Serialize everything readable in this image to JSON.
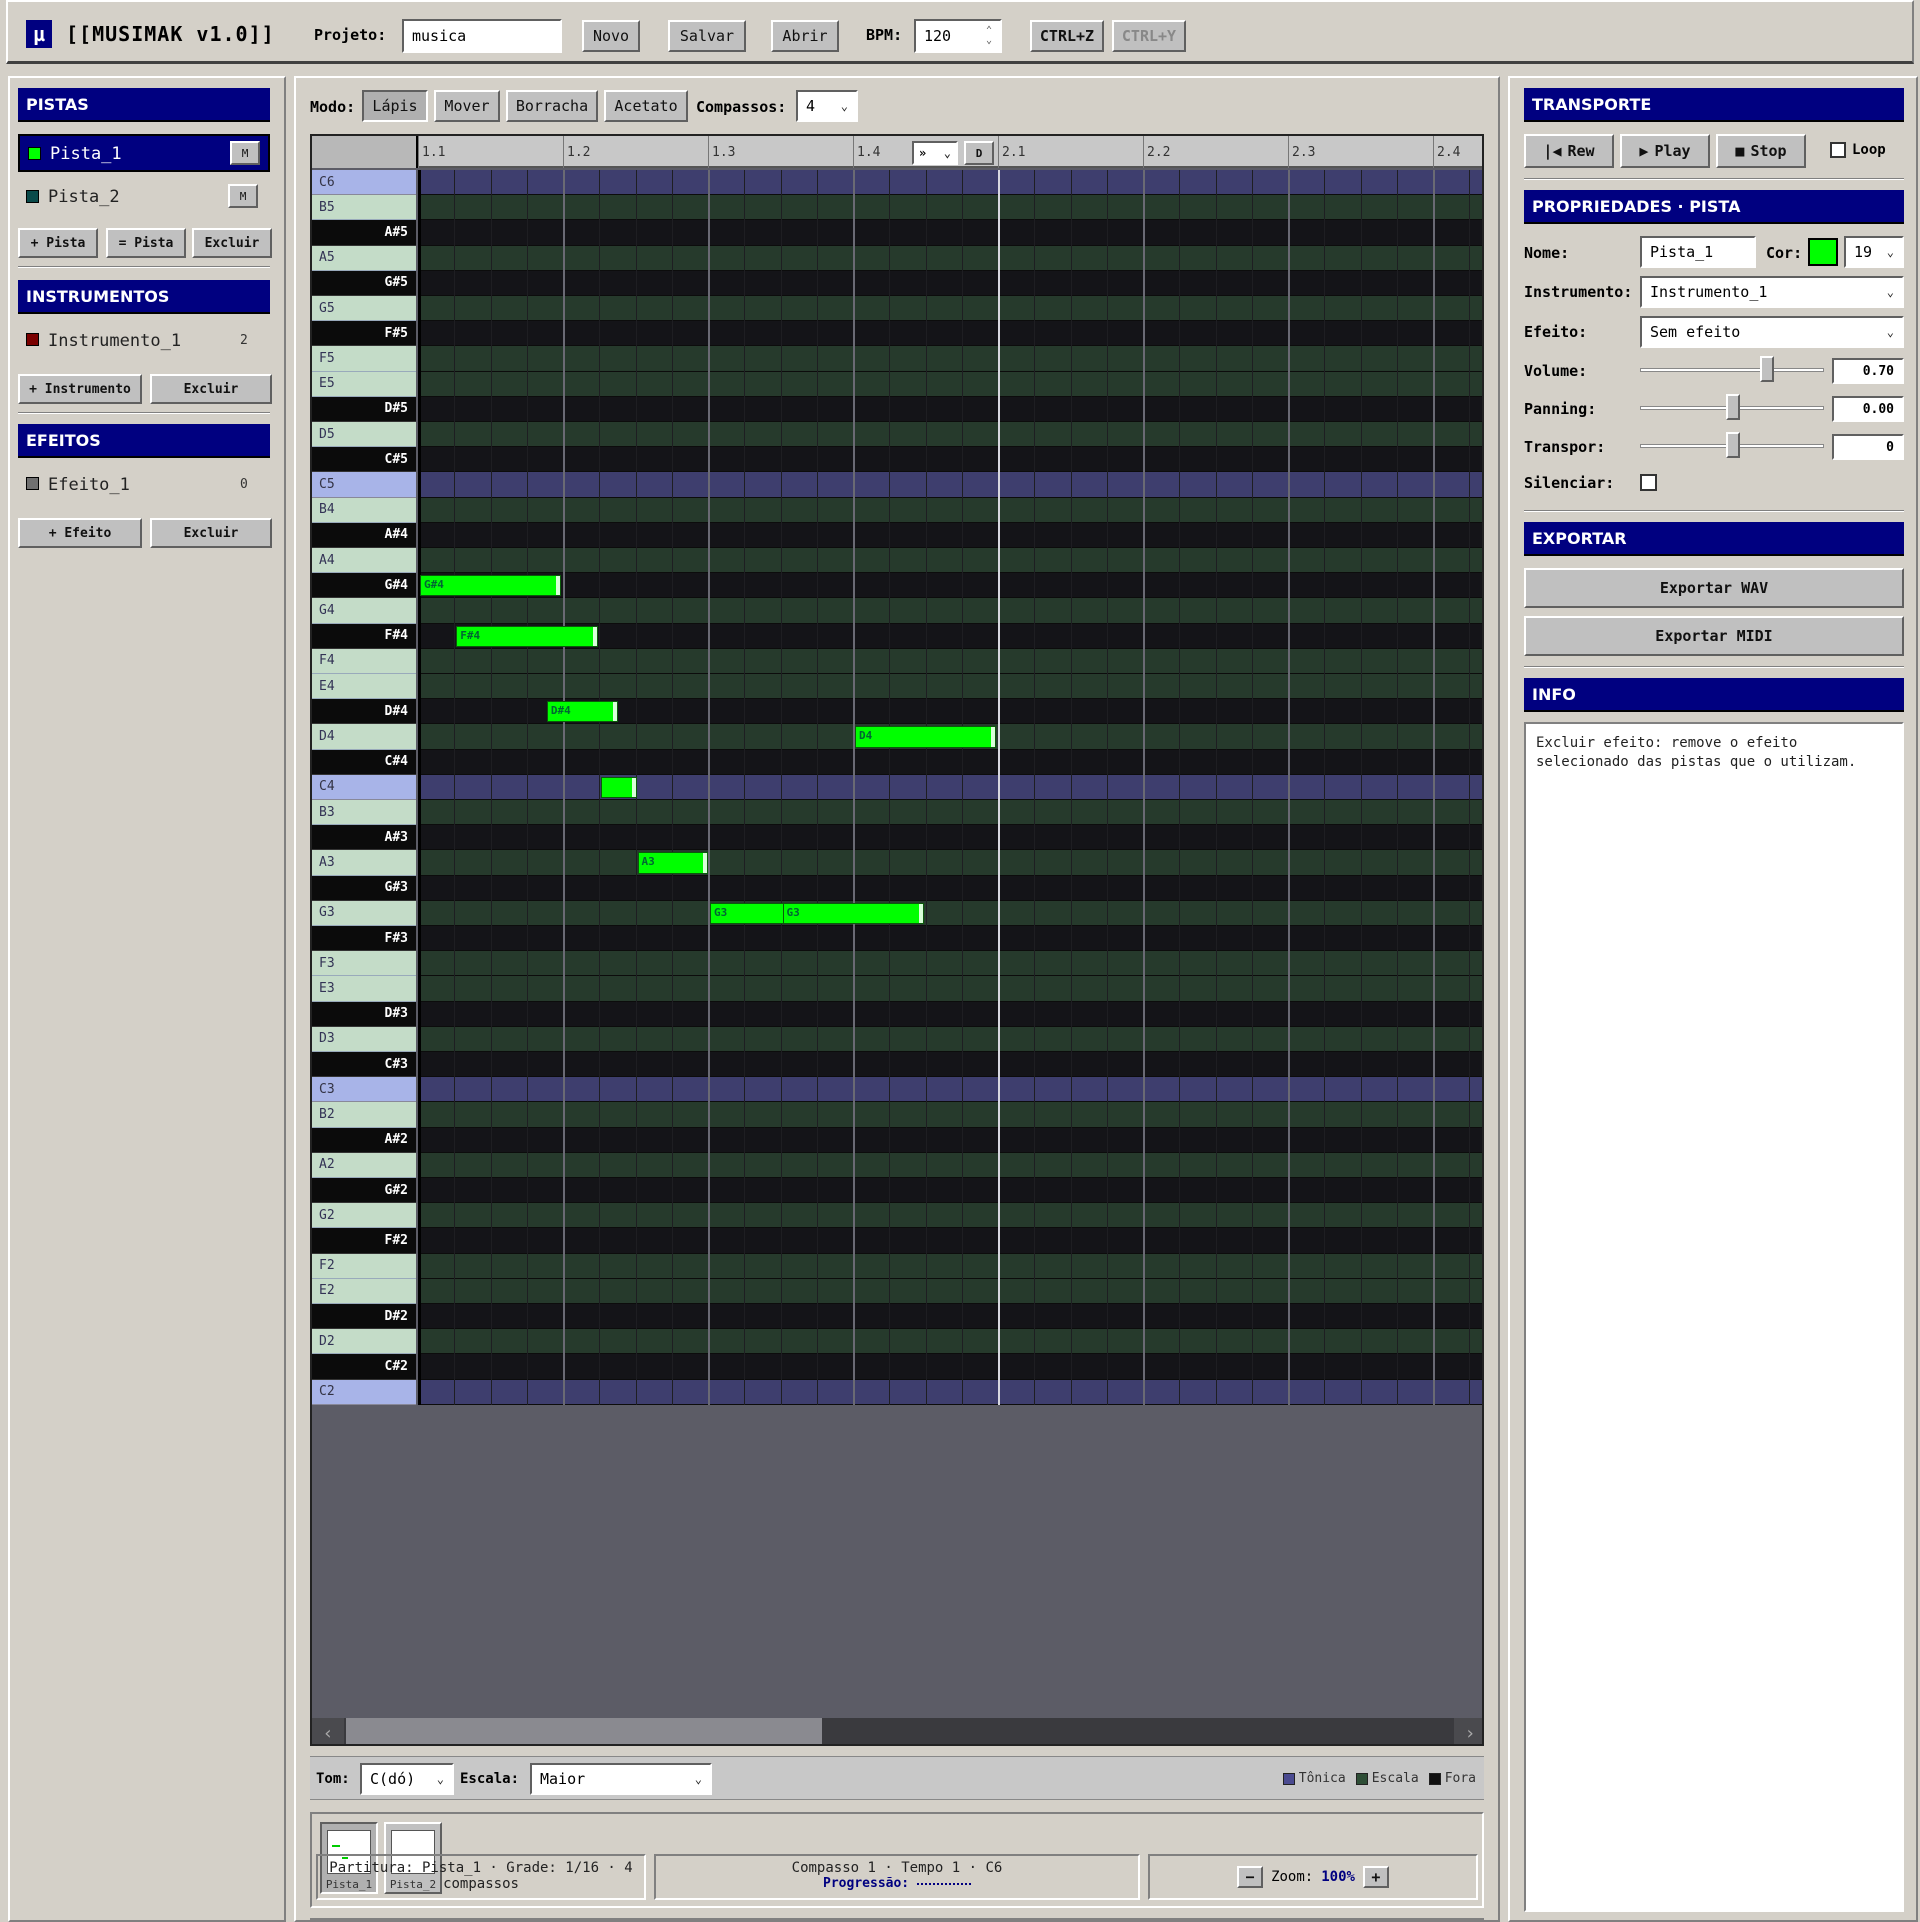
{
  "app": {
    "logo": "µ",
    "title": "[[MUSIMAK v1.0]]"
  },
  "toolbar": {
    "project_label": "Projeto:",
    "project_value": "musica",
    "new_label": "Novo",
    "save_label": "Salvar",
    "open_label": "Abrir",
    "bpm_label": "BPM:",
    "bpm_value": "120",
    "undo_label": "CTRL+Z",
    "redo_label": "CTRL+Y"
  },
  "tracks": {
    "header": "PISTAS",
    "items": [
      {
        "name": "Pista_1",
        "color": "#00ff00",
        "mute": "M",
        "selected": true
      },
      {
        "name": "Pista_2",
        "color": "#0a4a4a",
        "mute": "M",
        "selected": false
      }
    ],
    "add_label": "+ Pista",
    "dup_label": "= Pista",
    "delete_label": "Excluir"
  },
  "instruments": {
    "header": "INSTRUMENTOS",
    "items": [
      {
        "name": "Instrumento_1",
        "color": "#7a0000",
        "count": "2"
      }
    ],
    "add_label": "+ Instrumento",
    "delete_label": "Excluir"
  },
  "effects": {
    "header": "EFEITOS",
    "items": [
      {
        "name": "Efeito_1",
        "color": "#707070",
        "count": "0"
      }
    ],
    "add_label": "+ Efeito",
    "delete_label": "Excluir"
  },
  "editor": {
    "mode_label": "Modo:",
    "modes": [
      "Lápis",
      "Mover",
      "Borracha",
      "Acetato"
    ],
    "active_mode": "Lápis",
    "measures_label": "Compassos:",
    "measures_value": "4",
    "ruler": [
      "1.1",
      "1.2",
      "1.3",
      "1.4",
      "2.1",
      "2.2",
      "2.3",
      "2.4"
    ],
    "ruler_select": "»",
    "ruler_d": "D",
    "keys": [
      "C6",
      "B5",
      "A#5",
      "A5",
      "G#5",
      "G5",
      "F#5",
      "F5",
      "E5",
      "D#5",
      "D5",
      "C#5",
      "C5",
      "B4",
      "A#4",
      "A4",
      "G#4",
      "G4",
      "F#4",
      "F4",
      "E4",
      "D#4",
      "D4",
      "C#4",
      "C4",
      "B3",
      "A#3",
      "A3",
      "G#3",
      "G3",
      "F#3",
      "F3",
      "E3",
      "D#3",
      "D3",
      "C#3",
      "C3",
      "B2",
      "A#2",
      "A2",
      "G#2",
      "G2",
      "F#2",
      "F2",
      "E2",
      "D#2",
      "D2",
      "C#2",
      "C2"
    ],
    "notes": [
      {
        "pitch": "G#4",
        "start": 0,
        "length": 2,
        "label": "G#4"
      },
      {
        "pitch": "F#4",
        "start": 1,
        "length": 2,
        "label": "F#4"
      },
      {
        "pitch": "D#4",
        "start": 3.5,
        "length": 1,
        "label": "D#4"
      },
      {
        "pitch": "D4",
        "start": 12,
        "length": 2,
        "label": "D4"
      },
      {
        "pitch": "C4",
        "start": 5,
        "length": 0.5,
        "label": ""
      },
      {
        "pitch": "A3",
        "start": 6,
        "length": 1,
        "label": "A3"
      },
      {
        "pitch": "G3",
        "start": 8,
        "length": 2,
        "label": "G3"
      },
      {
        "pitch": "G3",
        "start": 10,
        "length": 2,
        "label": "G3"
      }
    ],
    "key_label": "Tom:",
    "key_value": "C(dó)",
    "scale_label": "Escala:",
    "scale_value": "Maior",
    "legend": [
      {
        "label": "Tônica",
        "color": "#4a4a90"
      },
      {
        "label": "Escala",
        "color": "#2e4e36"
      },
      {
        "label": "Fora",
        "color": "#111111"
      }
    ],
    "thumbnails": [
      "Pista_1",
      "Pista_2"
    ]
  },
  "status": {
    "left": "Partitura: Pista_1 · Grade: 1/16 · 4 compassos",
    "center": "Compasso 1 · Tempo 1 · C6",
    "progress_label": "Progressão:",
    "zoom_label": "Zoom:",
    "zoom_value": "100%",
    "zoom_minus": "−",
    "zoom_plus": "+"
  },
  "transport": {
    "header": "TRANSPORTE",
    "rew_label": "Rew",
    "play_label": "Play",
    "stop_label": "Stop",
    "loop_label": "Loop"
  },
  "properties": {
    "header": "PROPRIEDADES · PISTA",
    "name_label": "Nome:",
    "name_value": "Pista_1",
    "color_label": "Cor:",
    "color_value": "#00ff00",
    "color_index": "19",
    "instrument_label": "Instrumento:",
    "instrument_value": "Instrumento_1",
    "effect_label": "Efeito:",
    "effect_value": "Sem efeito",
    "volume_label": "Volume:",
    "volume_value": "0.70",
    "panning_label": "Panning:",
    "panning_value": "0.00",
    "transpose_label": "Transpor:",
    "transpose_value": "0",
    "mute_label": "Silenciar:"
  },
  "export": {
    "header": "EXPORTAR",
    "wav_label": "Exportar WAV",
    "midi_label": "Exportar MIDI"
  },
  "info": {
    "header": "INFO",
    "text": "Excluir efeito: remove o efeito selecionado das pistas que o utilizam."
  }
}
